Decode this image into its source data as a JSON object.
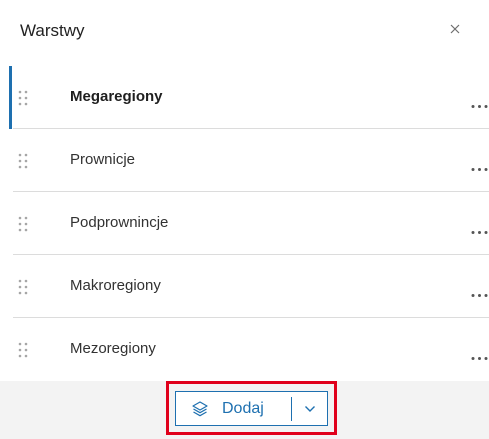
{
  "panel": {
    "title": "Warstwy",
    "close_icon": "close-icon"
  },
  "layers": [
    {
      "label": "Megaregiony",
      "selected": true
    },
    {
      "label": "Prownicje",
      "selected": false
    },
    {
      "label": "Podprownincje",
      "selected": false
    },
    {
      "label": "Makroregiony",
      "selected": false
    },
    {
      "label": "Mezoregiony",
      "selected": false
    }
  ],
  "footer": {
    "add_label": "Dodaj",
    "add_icon": "layers-icon",
    "dropdown_icon": "chevron-down-icon"
  },
  "colors": {
    "accent": "#1e70b0",
    "highlight": "#e0001b"
  }
}
